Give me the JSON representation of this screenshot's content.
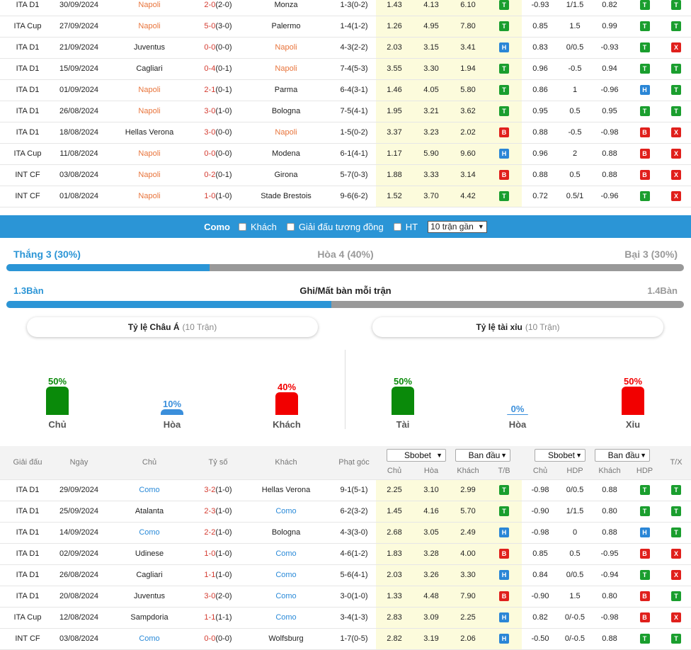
{
  "napoli_matches": [
    {
      "league": "ITA D1",
      "date": "30/09/2024",
      "home": "Napoli",
      "score": "2-0",
      "ht": "(2-0)",
      "away": "Monza",
      "corner": "1-3(0-2)",
      "o1": "1.43",
      "o2": "4.13",
      "o3": "6.10",
      "tb": "T",
      "a1": "-0.93",
      "a2": "1/1.5",
      "a3": "0.82",
      "hdp": "T",
      "tx": "T",
      "hl": "home"
    },
    {
      "league": "ITA Cup",
      "date": "27/09/2024",
      "home": "Napoli",
      "score": "5-0",
      "ht": "(3-0)",
      "away": "Palermo",
      "corner": "1-4(1-2)",
      "o1": "1.26",
      "o2": "4.95",
      "o3": "7.80",
      "tb": "T",
      "a1": "0.85",
      "a2": "1.5",
      "a3": "0.99",
      "hdp": "T",
      "tx": "T",
      "hl": "home"
    },
    {
      "league": "ITA D1",
      "date": "21/09/2024",
      "home": "Juventus",
      "score": "0-0",
      "ht": "(0-0)",
      "away": "Napoli",
      "corner": "4-3(2-2)",
      "o1": "2.03",
      "o2": "3.15",
      "o3": "3.41",
      "tb": "H",
      "a1": "0.83",
      "a2": "0/0.5",
      "a3": "-0.93",
      "hdp": "T",
      "tx": "X",
      "hl": "away"
    },
    {
      "league": "ITA D1",
      "date": "15/09/2024",
      "home": "Cagliari",
      "score": "0-4",
      "ht": "(0-1)",
      "away": "Napoli",
      "corner": "7-4(5-3)",
      "o1": "3.55",
      "o2": "3.30",
      "o3": "1.94",
      "tb": "T",
      "a1": "0.96",
      "a2": "-0.5",
      "a3": "0.94",
      "hdp": "T",
      "tx": "T",
      "hl": "away"
    },
    {
      "league": "ITA D1",
      "date": "01/09/2024",
      "home": "Napoli",
      "score": "2-1",
      "ht": "(0-1)",
      "away": "Parma",
      "corner": "6-4(3-1)",
      "o1": "1.46",
      "o2": "4.05",
      "o3": "5.80",
      "tb": "T",
      "a1": "0.86",
      "a2": "1",
      "a3": "-0.96",
      "hdp": "H",
      "tx": "T",
      "hl": "home"
    },
    {
      "league": "ITA D1",
      "date": "26/08/2024",
      "home": "Napoli",
      "score": "3-0",
      "ht": "(1-0)",
      "away": "Bologna",
      "corner": "7-5(4-1)",
      "o1": "1.95",
      "o2": "3.21",
      "o3": "3.62",
      "tb": "T",
      "a1": "0.95",
      "a2": "0.5",
      "a3": "0.95",
      "hdp": "T",
      "tx": "T",
      "hl": "home"
    },
    {
      "league": "ITA D1",
      "date": "18/08/2024",
      "home": "Hellas Verona",
      "score": "3-0",
      "ht": "(0-0)",
      "away": "Napoli",
      "corner": "1-5(0-2)",
      "o1": "3.37",
      "o2": "3.23",
      "o3": "2.02",
      "tb": "B",
      "a1": "0.88",
      "a2": "-0.5",
      "a3": "-0.98",
      "hdp": "B",
      "tx": "X",
      "hl": "away"
    },
    {
      "league": "ITA Cup",
      "date": "11/08/2024",
      "home": "Napoli",
      "score": "0-0",
      "ht": "(0-0)",
      "away": "Modena",
      "corner": "6-1(4-1)",
      "o1": "1.17",
      "o2": "5.90",
      "o3": "9.60",
      "tb": "H",
      "a1": "0.96",
      "a2": "2",
      "a3": "0.88",
      "hdp": "B",
      "tx": "X",
      "hl": "home"
    },
    {
      "league": "INT CF",
      "date": "03/08/2024",
      "home": "Napoli",
      "score": "0-2",
      "ht": "(0-1)",
      "away": "Girona",
      "corner": "5-7(0-3)",
      "o1": "1.88",
      "o2": "3.33",
      "o3": "3.14",
      "tb": "B",
      "a1": "0.88",
      "a2": "0.5",
      "a3": "0.88",
      "hdp": "B",
      "tx": "X",
      "hl": "home"
    },
    {
      "league": "INT CF",
      "date": "01/08/2024",
      "home": "Napoli",
      "score": "1-0",
      "ht": "(1-0)",
      "away": "Stade Brestois",
      "corner": "9-6(6-2)",
      "o1": "1.52",
      "o2": "3.70",
      "o3": "4.42",
      "tb": "T",
      "a1": "0.72",
      "a2": "0.5/1",
      "a3": "-0.96",
      "hdp": "T",
      "tx": "X",
      "hl": "home"
    }
  ],
  "filter_bar": {
    "team": "Como",
    "opt_away": "Khách",
    "opt_same_league": "Giải đấu tương đồng",
    "opt_ht": "HT",
    "select_value": "10 trận gần"
  },
  "summary": {
    "win": "Thắng 3 (30%)",
    "draw": "Hòa 4 (40%)",
    "loss": "Bại 3 (30%)",
    "win_fraction": 0.3,
    "goals_left": "1.3Bàn",
    "goals_title": "Ghi/Mất bàn mỗi trận",
    "goals_right": "1.4Bàn",
    "goals_fraction": 0.48
  },
  "asian_card": {
    "title": "Tỷ lệ Châu Á",
    "sub": "(10 Trận)",
    "bars": [
      {
        "pct": "50%",
        "value": 50,
        "label": "Chủ",
        "color": "#0a8a0a"
      },
      {
        "pct": "10%",
        "value": 10,
        "label": "Hòa",
        "color": "#3b8fdb"
      },
      {
        "pct": "40%",
        "value": 40,
        "label": "Khách",
        "color": "#f20000"
      }
    ]
  },
  "ou_card": {
    "title": "Tỷ lệ tài xỉu",
    "sub": "(10 Trận)",
    "bars": [
      {
        "pct": "50%",
        "value": 50,
        "label": "Tài",
        "color": "#0a8a0a"
      },
      {
        "pct": "0%",
        "value": 0,
        "label": "Hòa",
        "color": "#3b8fdb"
      },
      {
        "pct": "50%",
        "value": 50,
        "label": "Xỉu",
        "color": "#f20000"
      }
    ]
  },
  "header2": {
    "league": "Giải đấu",
    "date": "Ngày",
    "home": "Chủ",
    "score": "Tỷ số",
    "away": "Khách",
    "corner": "Phạt góc",
    "book1": "Sbobet",
    "type1": "Ban đầu",
    "book2": "Sbobet",
    "type2": "Ban đầu",
    "s1": "Chủ",
    "s2": "Hòa",
    "s3": "Khách",
    "s4": "T/B",
    "s5": "Chủ",
    "s6": "HDP",
    "s7": "Khách",
    "s8": "HDP",
    "tx": "T/X"
  },
  "como_matches": [
    {
      "league": "ITA D1",
      "date": "29/09/2024",
      "home": "Como",
      "score": "3-2",
      "ht": "(1-0)",
      "away": "Hellas Verona",
      "corner": "9-1(5-1)",
      "o1": "2.25",
      "o2": "3.10",
      "o3": "2.99",
      "tb": "T",
      "a1": "-0.98",
      "a2": "0/0.5",
      "a3": "0.88",
      "hdp": "T",
      "tx": "T",
      "hl": "home"
    },
    {
      "league": "ITA D1",
      "date": "25/09/2024",
      "home": "Atalanta",
      "score": "2-3",
      "ht": "(1-0)",
      "away": "Como",
      "corner": "6-2(3-2)",
      "o1": "1.45",
      "o2": "4.16",
      "o3": "5.70",
      "tb": "T",
      "a1": "-0.90",
      "a2": "1/1.5",
      "a3": "0.80",
      "hdp": "T",
      "tx": "T",
      "hl": "away"
    },
    {
      "league": "ITA D1",
      "date": "14/09/2024",
      "home": "Como",
      "score": "2-2",
      "ht": "(1-0)",
      "away": "Bologna",
      "corner": "4-3(3-0)",
      "o1": "2.68",
      "o2": "3.05",
      "o3": "2.49",
      "tb": "H",
      "a1": "-0.98",
      "a2": "0",
      "a3": "0.88",
      "hdp": "H",
      "tx": "T",
      "hl": "home"
    },
    {
      "league": "ITA D1",
      "date": "02/09/2024",
      "home": "Udinese",
      "score": "1-0",
      "ht": "(1-0)",
      "away": "Como",
      "corner": "4-6(1-2)",
      "o1": "1.83",
      "o2": "3.28",
      "o3": "4.00",
      "tb": "B",
      "a1": "0.85",
      "a2": "0.5",
      "a3": "-0.95",
      "hdp": "B",
      "tx": "X",
      "hl": "away"
    },
    {
      "league": "ITA D1",
      "date": "26/08/2024",
      "home": "Cagliari",
      "score": "1-1",
      "ht": "(1-0)",
      "away": "Como",
      "corner": "5-6(4-1)",
      "o1": "2.03",
      "o2": "3.26",
      "o3": "3.30",
      "tb": "H",
      "a1": "0.84",
      "a2": "0/0.5",
      "a3": "-0.94",
      "hdp": "T",
      "tx": "X",
      "hl": "away"
    },
    {
      "league": "ITA D1",
      "date": "20/08/2024",
      "home": "Juventus",
      "score": "3-0",
      "ht": "(2-0)",
      "away": "Como",
      "corner": "3-0(1-0)",
      "o1": "1.33",
      "o2": "4.48",
      "o3": "7.90",
      "tb": "B",
      "a1": "-0.90",
      "a2": "1.5",
      "a3": "0.80",
      "hdp": "B",
      "tx": "T",
      "hl": "away"
    },
    {
      "league": "ITA Cup",
      "date": "12/08/2024",
      "home": "Sampdoria",
      "score": "1-1",
      "ht": "(1-1)",
      "away": "Como",
      "corner": "3-4(1-3)",
      "o1": "2.83",
      "o2": "3.09",
      "o3": "2.25",
      "tb": "H",
      "a1": "0.82",
      "a2": "0/-0.5",
      "a3": "-0.98",
      "hdp": "B",
      "tx": "X",
      "hl": "away"
    },
    {
      "league": "INT CF",
      "date": "03/08/2024",
      "home": "Como",
      "score": "0-0",
      "ht": "(0-0)",
      "away": "Wolfsburg",
      "corner": "1-7(0-5)",
      "o1": "2.82",
      "o2": "3.19",
      "o3": "2.06",
      "tb": "H",
      "a1": "-0.50",
      "a2": "0/-0.5",
      "a3": "0.88",
      "hdp": "T",
      "tx": "T",
      "hl": "home"
    }
  ]
}
